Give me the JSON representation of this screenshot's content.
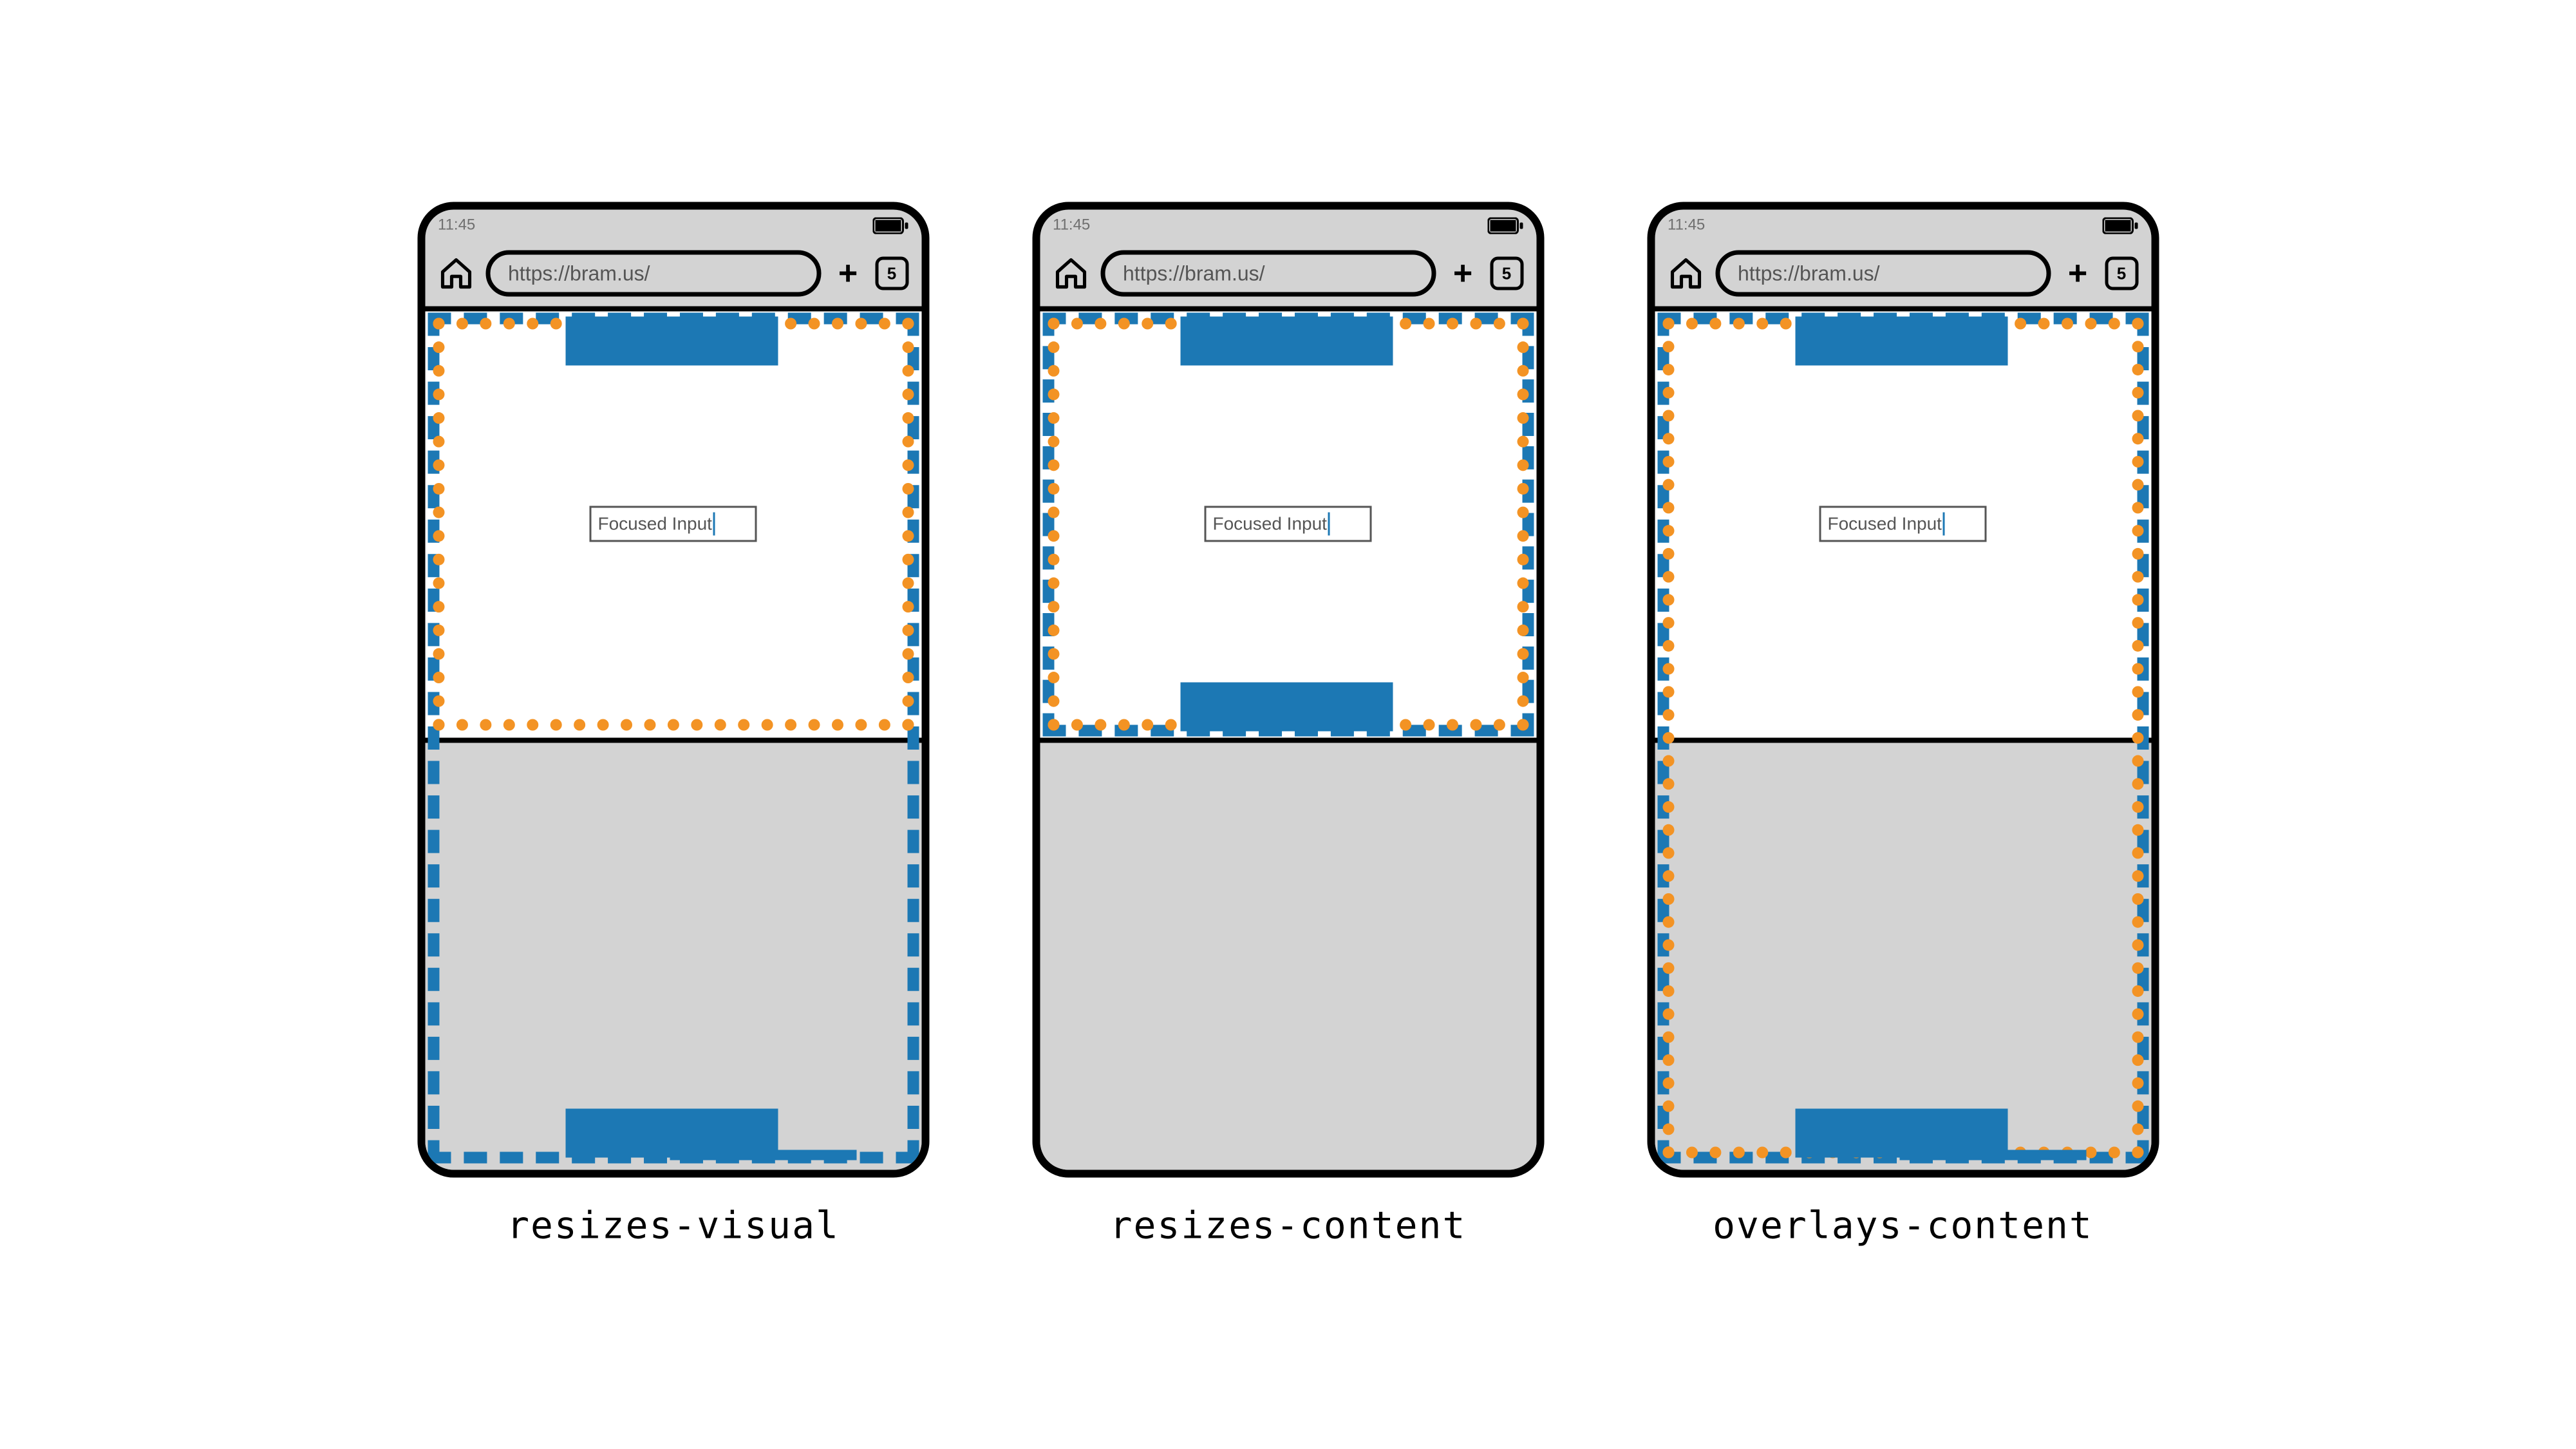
{
  "common": {
    "clock": "11:45",
    "url": "https://bram.us/",
    "tab_count": "5",
    "input_label": "Focused Input"
  },
  "captions": {
    "a": "resizes-visual",
    "b": "resizes-content",
    "c": "overlays-content"
  },
  "colors": {
    "accent": "#1c78b4",
    "dotted": "#f39324",
    "chrome": "#d3d3d3"
  }
}
